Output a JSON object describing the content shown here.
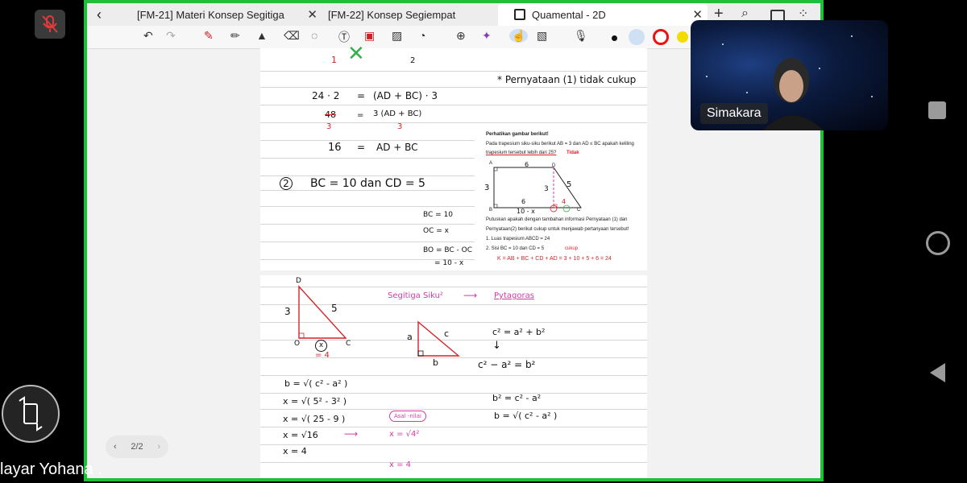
{
  "mute_icon": "mic-off-icon",
  "tabs": [
    {
      "label": "[FM-21] Materi Konsep Segitiga"
    },
    {
      "label": "[FM-22] Konsep Segiempat"
    },
    {
      "label": "Quamental - 2D"
    }
  ],
  "participant": {
    "name": "Simakara"
  },
  "sharer_label": "layar Yohana .",
  "pager": {
    "label": "2/2"
  },
  "page1": {
    "top_right_note": "* Pernyataan (1) tidak cukup",
    "eq1_left": "24 · 2",
    "eq1_eq": "=",
    "eq1_right": "(AD + BC) · 3",
    "eq2_left": "48",
    "eq2_under": "3",
    "eq2_eq": "=",
    "eq2_right": "3  (AD + BC)",
    "eq2_under_right": "3",
    "eq3_left": "16",
    "eq3_eq": "=",
    "eq3_right": "AD + BC",
    "stmt2": "BC  =  10   dan   CD  =  5",
    "stmt2_num": "2",
    "bc": "BC = 10",
    "oc": "OC = x",
    "bo": "BO = BC - OC",
    "bo2": "= 10 - x",
    "problem_title": "Perhatikan gambar berikut!",
    "problem_l1": "Pada trapesium siku-siku berikut AB = 3 dan AD ≤ BC apakah keliling",
    "problem_l2": "trapesium tersebut lebih dari 25?",
    "problem_tidak": "Tidak",
    "problem_l3": "Putuskan apakah dengan tambahan informasi Pernyataan (1) dan",
    "problem_l4": "Pernyataan(2) berikut cukup untuk menjawab pertanyaan tersebut!",
    "problem_l5": "1. Luas trapesium ABCD = 24",
    "problem_l6": "2. Sisi BC = 10 dan CD = 5",
    "problem_cukup": "cukup",
    "k_line": "K = AB + BC + CD + AD  =  3 + 10 + 5 + 6  = 24",
    "fig_a": "A",
    "fig_b": "B",
    "fig_c": "C",
    "fig_d": "D",
    "fig_top6": "6",
    "fig_3": "3",
    "fig_5": "5",
    "fig_3b": "3",
    "fig_6b": "6",
    "fig_4": "4",
    "fig_10x": "10 - x"
  },
  "page2": {
    "title_left": "Segitiga  Siku²",
    "arrow": "⟶",
    "title_right": "Pytagoras",
    "tri1_d": "D",
    "tri1_3": "3",
    "tri1_5": "5",
    "tri1_o": "O",
    "tri1_c": "C",
    "tri1_x": "x",
    "tri1_eq4": "= 4",
    "tri2_a": "a",
    "tri2_c": "c",
    "tri2_b": "b",
    "f1": "c²  =  a²  +  b²",
    "f1_arrow": "↓",
    "f2": "c² − a²  =       b²",
    "calc1": "b  =  √( c²  - a² )",
    "calc2": "x  =  √( 5²  - 3² )",
    "calc3": "x  =  √( 25  -  9 )",
    "calc4": "x  =  √16",
    "calc5": "x  =  4",
    "asal": "Asal -nilai",
    "pink_x": "x = √4²",
    "pink_x2": "x = 4",
    "f3": "b²  =   c²  -  a²",
    "f4": "b  =  √( c²  -  a² )"
  }
}
